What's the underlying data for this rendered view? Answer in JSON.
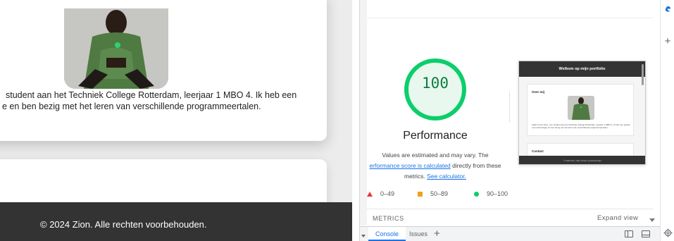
{
  "website": {
    "intro_line_1": "student aan het Techniek College Rotterdam, leerjaar 1 MBO 4. Ik heb een",
    "intro_line_2": "e en ben bezig met het leren van verschillende programmeertalen.",
    "footer_text": "© 2024 Zion. Alle rechten voorbehouden."
  },
  "lighthouse": {
    "score": "100",
    "score_fraction": 1.0,
    "category_title": "Performance",
    "desc_line_1": "Values are estimated and may vary. The",
    "desc_link_1": "erformance score is calculated",
    "desc_line_2_rest": " directly from these",
    "desc_line_3_prefix": "metrics. ",
    "desc_link_2": "See calculator.",
    "legend": {
      "poor": "0–49",
      "average": "50–89",
      "good": "90–100"
    },
    "colors": {
      "good": "#0cce6b",
      "average": "#f0a21a",
      "poor": "#e53935",
      "score_text": "#0c7d3f"
    },
    "metrics_label": "METRICS",
    "expand_label": "Expand view",
    "thumbnail": {
      "header": "Welkom op mijn portfolio",
      "section_about": "Over mij",
      "section_contact": "Contact",
      "about_text": "Hallo! Ik ben Zion, een student aan het Techniek College Rotterdam, leerjaar 1 MBO 4. Ik heb een passie voor technologie en ben bezig met het leren van verschillende programmeertalen.",
      "footer": "© 2024 Zion. Alle rechten voorbehouden."
    }
  },
  "drawer": {
    "tab_console": "Console",
    "tab_issues": "Issues",
    "add_tab": "+"
  },
  "sidebar": {
    "plus": "+"
  },
  "icons": {
    "gauge": "score-gauge-icon",
    "poor": "triangle-icon",
    "average": "square-icon",
    "good": "circle-icon",
    "dock_left": "dock-side-icon",
    "dock_bottom": "dock-bottom-icon",
    "settings": "gear-icon",
    "brand": "edge-logo-icon"
  }
}
